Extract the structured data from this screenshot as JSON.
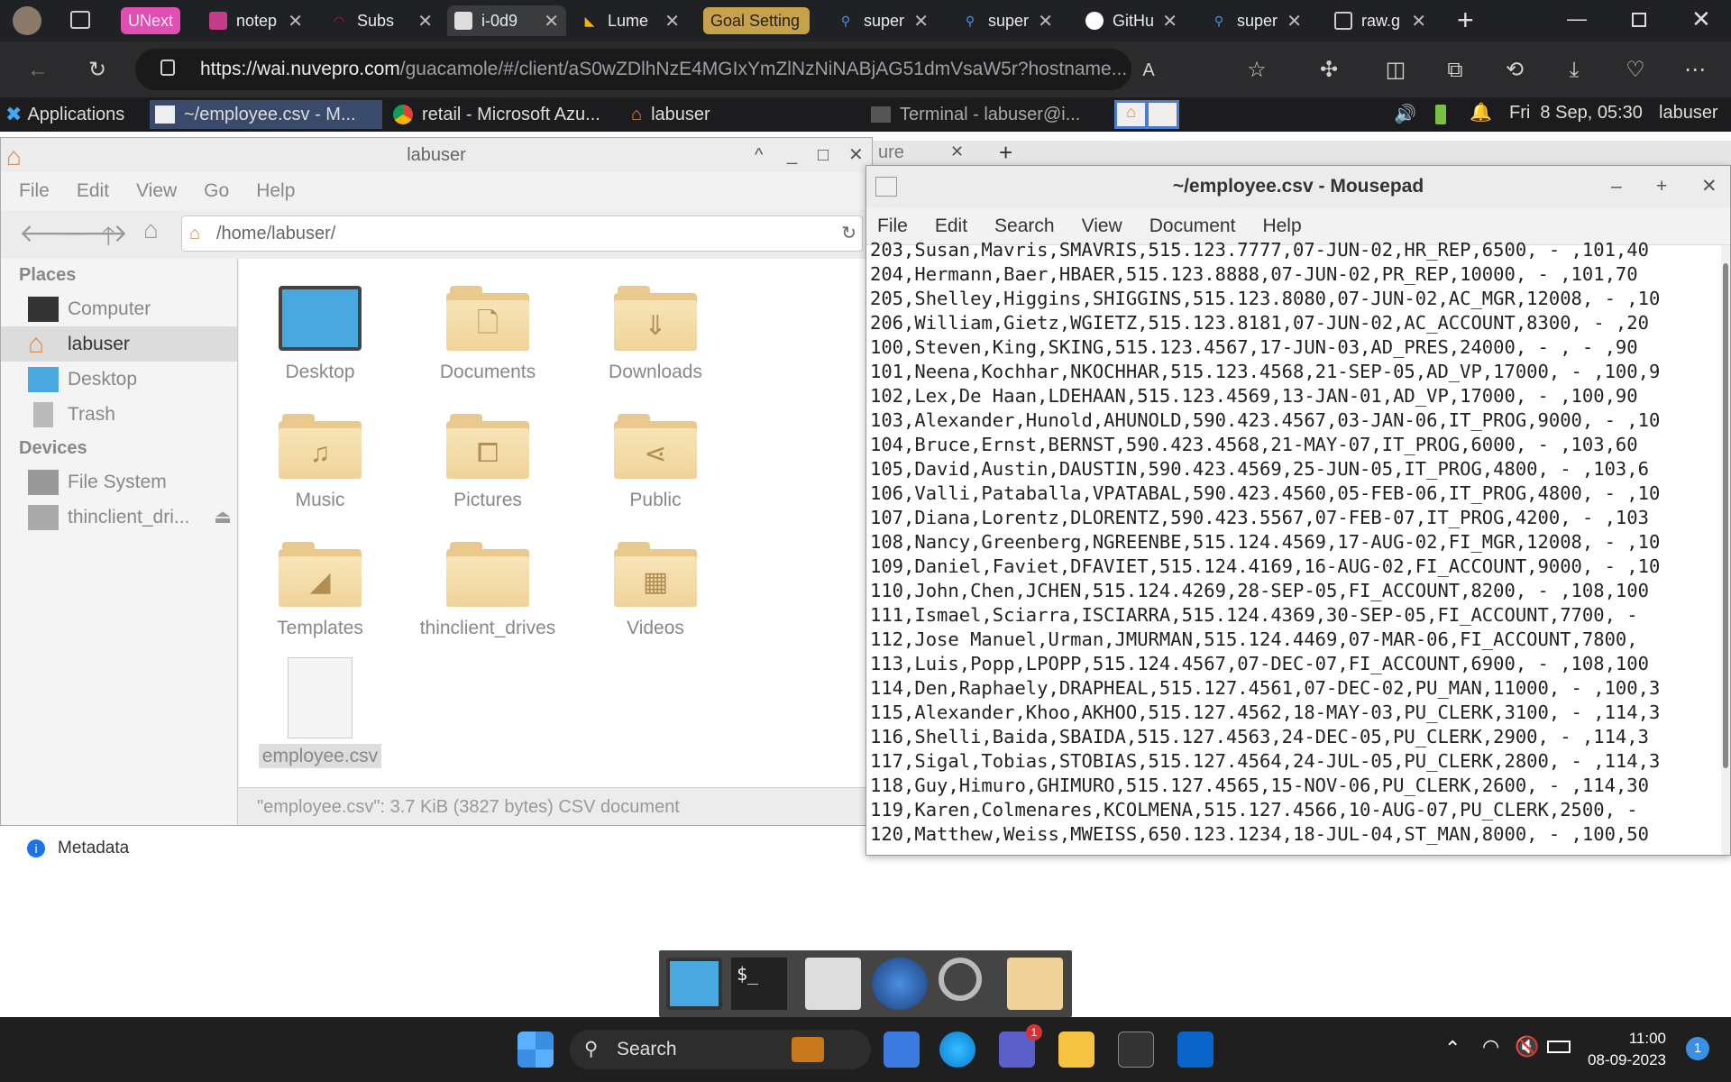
{
  "browser": {
    "tabs": [
      {
        "label": "UNext",
        "color": "#e04fb2"
      },
      {
        "label": "notep",
        "color": ""
      },
      {
        "label": "Subs",
        "color": ""
      },
      {
        "label": "i-0d9",
        "color": ""
      },
      {
        "label": "Lume",
        "color": ""
      },
      {
        "label": "Goal Setting",
        "color": "#c8a24a"
      },
      {
        "label": "super",
        "color": ""
      },
      {
        "label": "super",
        "color": ""
      },
      {
        "label": "GitHu",
        "color": ""
      },
      {
        "label": "super",
        "color": ""
      },
      {
        "label": "raw.g",
        "color": ""
      }
    ],
    "url_host": "https://wai.nuvepro.com",
    "url_path": "/guacamole/#/client/aS0wZDlhNzE4MGIxYmZlNzNiNABjAG51dmVsaW5r?hostname..."
  },
  "xfce_panel": {
    "applications": "Applications",
    "tasks": [
      "~/employee.csv - M...",
      "retail - Microsoft Azu...",
      "labuser",
      "Terminal - labuser@i..."
    ],
    "datetime": "Fri  8 Sep, 05:30",
    "user": "labuser"
  },
  "thunar": {
    "title": "labuser",
    "menu": [
      "File",
      "Edit",
      "View",
      "Go",
      "Help"
    ],
    "path": "/home/labuser/",
    "places_heading": "Places",
    "places": [
      "Computer",
      "labuser",
      "Desktop",
      "Trash"
    ],
    "devices_heading": "Devices",
    "devices": [
      "File System",
      "thinclient_dri..."
    ],
    "files": [
      "Desktop",
      "Documents",
      "Downloads",
      "Music",
      "Pictures",
      "Public",
      "Templates",
      "thinclient_drives",
      "Videos",
      "employee.csv"
    ],
    "status": "\"employee.csv\": 3.7 KiB (3827 bytes) CSV document"
  },
  "metadata_label": "Metadata",
  "background_tab": "ure",
  "mousepad": {
    "title": "~/employee.csv - Mousepad",
    "menu": [
      "File",
      "Edit",
      "Search",
      "View",
      "Document",
      "Help"
    ],
    "lines": [
      "203,Susan,Mavris,SMAVRIS,515.123.7777,07-JUN-02,HR_REP,6500, - ,101,40",
      "204,Hermann,Baer,HBAER,515.123.8888,07-JUN-02,PR_REP,10000, - ,101,70",
      "205,Shelley,Higgins,SHIGGINS,515.123.8080,07-JUN-02,AC_MGR,12008, - ,10",
      "206,William,Gietz,WGIETZ,515.123.8181,07-JUN-02,AC_ACCOUNT,8300, - ,20",
      "100,Steven,King,SKING,515.123.4567,17-JUN-03,AD_PRES,24000, - , - ,90",
      "101,Neena,Kochhar,NKOCHHAR,515.123.4568,21-SEP-05,AD_VP,17000, - ,100,9",
      "102,Lex,De Haan,LDEHAAN,515.123.4569,13-JAN-01,AD_VP,17000, - ,100,90",
      "103,Alexander,Hunold,AHUNOLD,590.423.4567,03-JAN-06,IT_PROG,9000, - ,10",
      "104,Bruce,Ernst,BERNST,590.423.4568,21-MAY-07,IT_PROG,6000, - ,103,60",
      "105,David,Austin,DAUSTIN,590.423.4569,25-JUN-05,IT_PROG,4800, - ,103,6",
      "106,Valli,Pataballa,VPATABAL,590.423.4560,05-FEB-06,IT_PROG,4800, - ,10",
      "107,Diana,Lorentz,DLORENTZ,590.423.5567,07-FEB-07,IT_PROG,4200, - ,103",
      "108,Nancy,Greenberg,NGREENBE,515.124.4569,17-AUG-02,FI_MGR,12008, - ,10",
      "109,Daniel,Faviet,DFAVIET,515.124.4169,16-AUG-02,FI_ACCOUNT,9000, - ,10",
      "110,John,Chen,JCHEN,515.124.4269,28-SEP-05,FI_ACCOUNT,8200, - ,108,100",
      "111,Ismael,Sciarra,ISCIARRA,515.124.4369,30-SEP-05,FI_ACCOUNT,7700, -",
      "112,Jose Manuel,Urman,JMURMAN,515.124.4469,07-MAR-06,FI_ACCOUNT,7800,",
      "113,Luis,Popp,LPOPP,515.124.4567,07-DEC-07,FI_ACCOUNT,6900, - ,108,100",
      "114,Den,Raphaely,DRAPHEAL,515.127.4561,07-DEC-02,PU_MAN,11000, - ,100,3",
      "115,Alexander,Khoo,AKHOO,515.127.4562,18-MAY-03,PU_CLERK,3100, - ,114,3",
      "116,Shelli,Baida,SBAIDA,515.127.4563,24-DEC-05,PU_CLERK,2900, - ,114,3",
      "117,Sigal,Tobias,STOBIAS,515.127.4564,24-JUL-05,PU_CLERK,2800, - ,114,3",
      "118,Guy,Himuro,GHIMURO,515.127.4565,15-NOV-06,PU_CLERK,2600, - ,114,30",
      "119,Karen,Colmenares,KCOLMENA,515.127.4566,10-AUG-07,PU_CLERK,2500, -",
      "120,Matthew,Weiss,MWEISS,650.123.1234,18-JUL-04,ST_MAN,8000, - ,100,50"
    ]
  },
  "taskbar": {
    "search": "Search",
    "time": "11:00",
    "date": "08-09-2023",
    "notification_count": "1",
    "teams_badge": "1"
  }
}
